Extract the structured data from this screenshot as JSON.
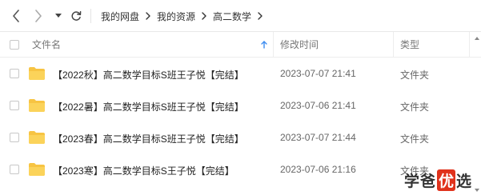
{
  "nav": {
    "breadcrumbs": [
      "我的网盘",
      "我的资源",
      "高二数学"
    ]
  },
  "header": {
    "name_label": "文件名",
    "modified_label": "修改时间",
    "type_label": "类型"
  },
  "files": [
    {
      "name": "【2022秋】高二数学目标S班王子悦【完结】",
      "modified": "2023-07-07 21:41",
      "type": "文件夹"
    },
    {
      "name": "【2022暑】高二数学目标S班王子悦【完结】",
      "modified": "2023-07-06 21:41",
      "type": "文件夹"
    },
    {
      "name": "【2023春】高二数学目标S班王子悦【完结】",
      "modified": "2023-07-07 21:44",
      "type": "文件夹"
    },
    {
      "name": "【2023寒】高二数学目标S王子悦【完结】",
      "modified": "2023-07-06 21:16",
      "type": "文件夹"
    }
  ],
  "watermark": {
    "part1": "学爸",
    "part2": "优",
    "part3": "选"
  },
  "colors": {
    "folder": "#f7c443",
    "sort_arrow": "#3c8cf0",
    "watermark_red": "#e0321c"
  },
  "icons": {
    "back": "chevron-left-icon",
    "forward": "chevron-right-icon",
    "history": "caret-down-icon",
    "refresh": "refresh-icon",
    "sort": "sort-up-icon",
    "folder": "folder-icon"
  }
}
